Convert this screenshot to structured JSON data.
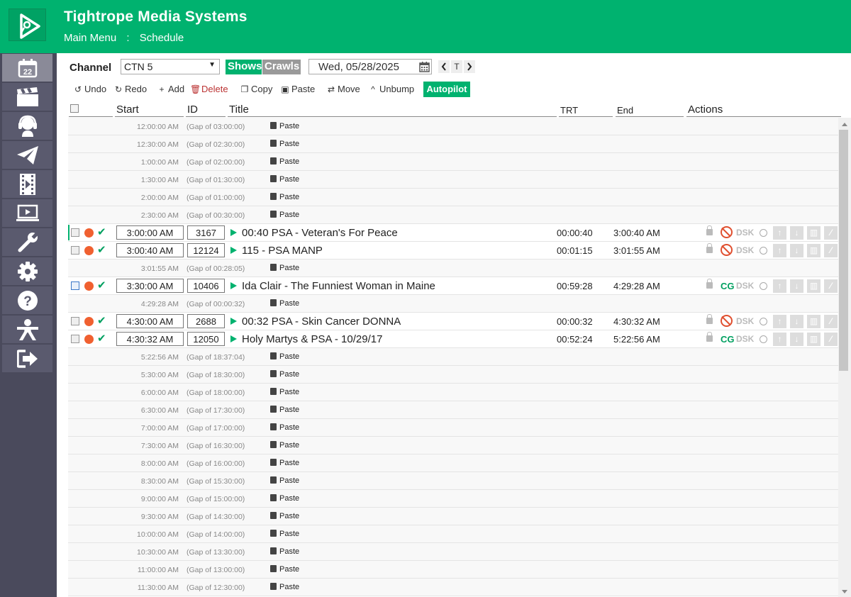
{
  "header": {
    "title": "Tightrope Media Systems",
    "breadcrumb": [
      "Main Menu",
      ":",
      "Schedule"
    ]
  },
  "sidebar": {
    "items": [
      {
        "name": "calendar-icon",
        "label": "22",
        "active": true
      },
      {
        "name": "clapperboard-icon"
      },
      {
        "name": "support-headset-icon"
      },
      {
        "name": "paper-plane-icon"
      },
      {
        "name": "film-icon"
      },
      {
        "name": "monitor-play-icon"
      },
      {
        "name": "wrench-icon"
      },
      {
        "name": "gear-icon"
      },
      {
        "name": "help-icon"
      },
      {
        "name": "person-icon"
      },
      {
        "name": "logout-icon"
      }
    ]
  },
  "toolbar": {
    "channel_label": "Channel",
    "channel_value": "CTN 5",
    "shows_label": "Shows",
    "crawls_label": "Crawls",
    "date_value": "Wed, 05/28/2025",
    "today_label": "T",
    "undo_label": "Undo",
    "redo_label": "Redo",
    "add_label": "Add",
    "delete_label": "Delete",
    "copy_label": "Copy",
    "paste_label": "Paste",
    "move_label": "Move",
    "unbump_label": "Unbump",
    "autopilot_label": "Autopilot"
  },
  "columns": {
    "start": "Start",
    "id": "ID",
    "title": "Title",
    "trt": "TRT",
    "end": "End",
    "actions": "Actions"
  },
  "schedule": [
    {
      "type": "gap",
      "time": "12:00:00 AM",
      "gap": "(Gap of 03:00:00)",
      "action": "Paste"
    },
    {
      "type": "gap",
      "time": "12:30:00 AM",
      "gap": "(Gap of 02:30:00)",
      "action": "Paste"
    },
    {
      "type": "gap",
      "time": "1:00:00 AM",
      "gap": "(Gap of 02:00:00)",
      "action": "Paste"
    },
    {
      "type": "gap",
      "time": "1:30:00 AM",
      "gap": "(Gap of 01:30:00)",
      "action": "Paste"
    },
    {
      "type": "gap",
      "time": "2:00:00 AM",
      "gap": "(Gap of 01:00:00)",
      "action": "Paste"
    },
    {
      "type": "gap",
      "time": "2:30:00 AM",
      "gap": "(Gap of 00:30:00)",
      "action": "Paste"
    },
    {
      "type": "event",
      "start": "3:00:00 AM",
      "id": "3167",
      "title": "00:40 PSA - Veteran's For Peace",
      "trt": "00:00:40",
      "end": "3:00:40 AM",
      "cg": false,
      "dsk": "DSK",
      "current": true
    },
    {
      "type": "event",
      "start": "3:00:40 AM",
      "id": "12124",
      "title": "115 - PSA MANP",
      "trt": "00:01:15",
      "end": "3:01:55 AM",
      "cg": false,
      "dsk": "DSK"
    },
    {
      "type": "gap",
      "time": "3:01:55 AM",
      "gap": "(Gap of 00:28:05)",
      "action": "Paste"
    },
    {
      "type": "event",
      "start": "3:30:00 AM",
      "id": "10406",
      "title": "Ida Clair - The Funniest Woman in Maine",
      "trt": "00:59:28",
      "end": "4:29:28 AM",
      "cg": true,
      "cg_label": "CG",
      "dsk": "DSK",
      "highlight": true
    },
    {
      "type": "gap",
      "time": "4:29:28 AM",
      "gap": "(Gap of 00:00:32)",
      "action": "Paste"
    },
    {
      "type": "event",
      "start": "4:30:00 AM",
      "id": "2688",
      "title": "00:32 PSA - Skin Cancer DONNA",
      "trt": "00:00:32",
      "end": "4:30:32 AM",
      "cg": false,
      "dsk": "DSK"
    },
    {
      "type": "event",
      "start": "4:30:32 AM",
      "id": "12050",
      "title": "Holy Martys & PSA - 10/29/17",
      "trt": "00:52:24",
      "end": "5:22:56 AM",
      "cg": true,
      "cg_label": "CG",
      "dsk": "DSK"
    },
    {
      "type": "gap",
      "time": "5:22:56 AM",
      "gap": "(Gap of 18:37:04)",
      "action": "Paste"
    },
    {
      "type": "gap",
      "time": "5:30:00 AM",
      "gap": "(Gap of 18:30:00)",
      "action": "Paste"
    },
    {
      "type": "gap",
      "time": "6:00:00 AM",
      "gap": "(Gap of 18:00:00)",
      "action": "Paste"
    },
    {
      "type": "gap",
      "time": "6:30:00 AM",
      "gap": "(Gap of 17:30:00)",
      "action": "Paste"
    },
    {
      "type": "gap",
      "time": "7:00:00 AM",
      "gap": "(Gap of 17:00:00)",
      "action": "Paste"
    },
    {
      "type": "gap",
      "time": "7:30:00 AM",
      "gap": "(Gap of 16:30:00)",
      "action": "Paste"
    },
    {
      "type": "gap",
      "time": "8:00:00 AM",
      "gap": "(Gap of 16:00:00)",
      "action": "Paste"
    },
    {
      "type": "gap",
      "time": "8:30:00 AM",
      "gap": "(Gap of 15:30:00)",
      "action": "Paste"
    },
    {
      "type": "gap",
      "time": "9:00:00 AM",
      "gap": "(Gap of 15:00:00)",
      "action": "Paste"
    },
    {
      "type": "gap",
      "time": "9:30:00 AM",
      "gap": "(Gap of 14:30:00)",
      "action": "Paste"
    },
    {
      "type": "gap",
      "time": "10:00:00 AM",
      "gap": "(Gap of 14:00:00)",
      "action": "Paste"
    },
    {
      "type": "gap",
      "time": "10:30:00 AM",
      "gap": "(Gap of 13:30:00)",
      "action": "Paste"
    },
    {
      "type": "gap",
      "time": "11:00:00 AM",
      "gap": "(Gap of 13:00:00)",
      "action": "Paste"
    },
    {
      "type": "gap",
      "time": "11:30:00 AM",
      "gap": "(Gap of 12:30:00)",
      "action": "Paste"
    }
  ]
}
